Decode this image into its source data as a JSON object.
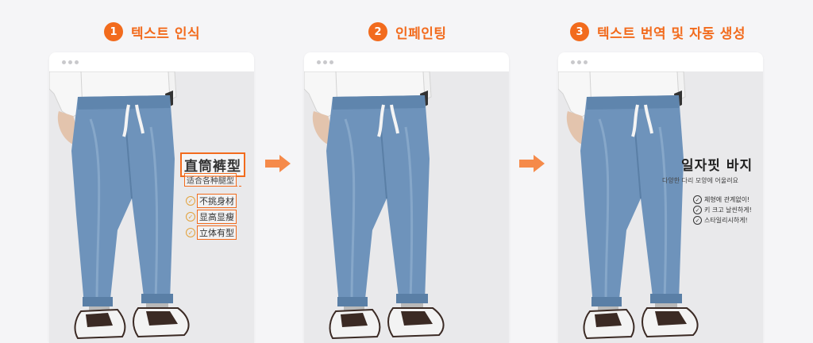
{
  "colors": {
    "accent": "#f26b1d",
    "background": "#f5f5f7",
    "denim": "#6e93bb"
  },
  "steps": [
    {
      "num": "1",
      "label": "텍스트 인식"
    },
    {
      "num": "2",
      "label": "인페인팅"
    },
    {
      "num": "3",
      "label": "텍스트 번역 및 자동 생성"
    }
  ],
  "icons": {
    "arrow": "arrow-right-icon",
    "window_dots": "window-dots-icon",
    "check": "check-circle-icon"
  },
  "frame1": {
    "title": "直筒裤型",
    "subtitle": "适合各种腿型",
    "features": [
      "不挑身材",
      "显高显瘦",
      "立体有型"
    ]
  },
  "frame3": {
    "title": "일자핏 바지",
    "subtitle": "다양한 다리 모양에 어울려요",
    "features": [
      "체형에 관계없이!",
      "키 크고 날씬하게!",
      "스타일리시하게!"
    ]
  }
}
